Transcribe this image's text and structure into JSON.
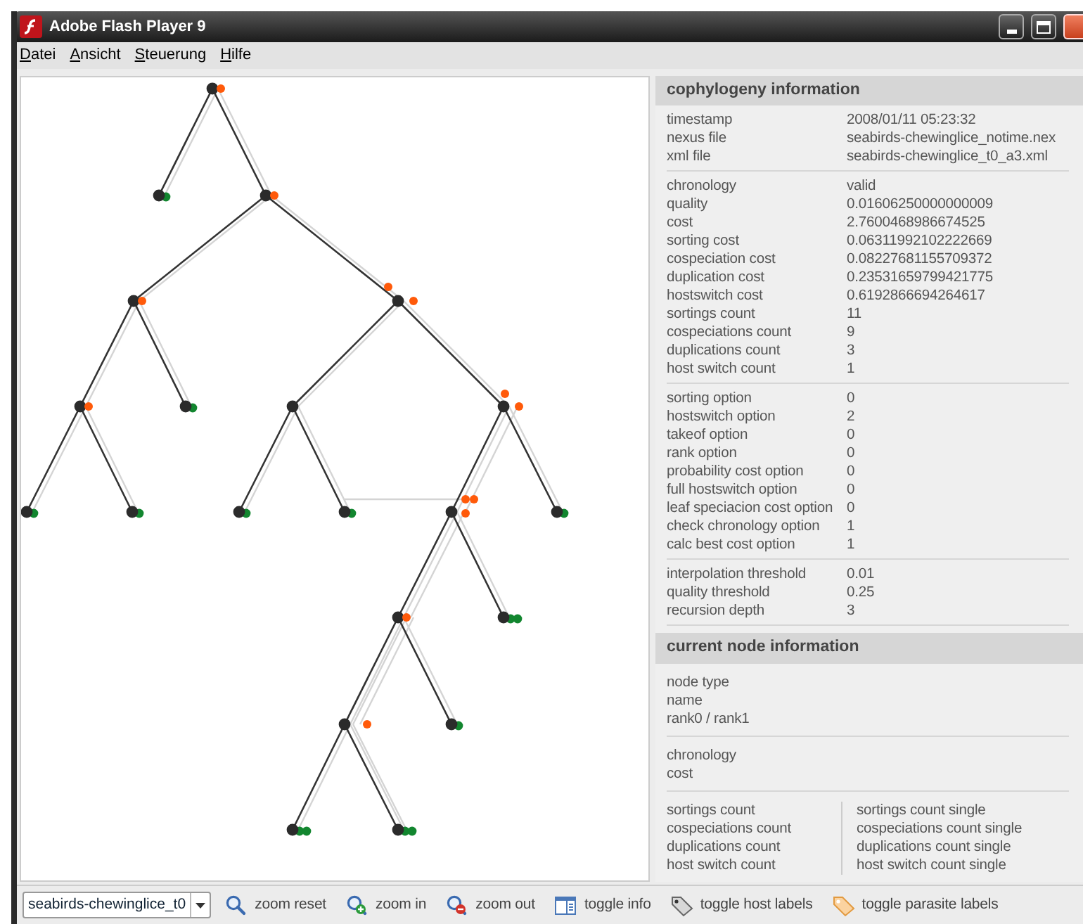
{
  "window": {
    "title": "Adobe Flash Player 9"
  },
  "menu": [
    "Datei",
    "Ansicht",
    "Steuerung",
    "Hilfe"
  ],
  "cophylogeny_information": {
    "title": "cophylogeny information",
    "groups": [
      [
        {
          "label": "timestamp",
          "value": "2008/01/11 05:23:32"
        },
        {
          "label": "nexus file",
          "value": "seabirds-chewinglice_notime.nex"
        },
        {
          "label": "xml file",
          "value": "seabirds-chewinglice_t0_a3.xml"
        }
      ],
      [
        {
          "label": "chronology",
          "value": "valid"
        },
        {
          "label": "quality",
          "value": "0.01606250000000009"
        },
        {
          "label": "cost",
          "value": "2.7600468986674525"
        },
        {
          "label": "sorting cost",
          "value": "0.06311992102222669"
        },
        {
          "label": "cospeciation cost",
          "value": "0.08227681155709372"
        },
        {
          "label": "duplication cost",
          "value": "0.23531659799421775"
        },
        {
          "label": "hostswitch cost",
          "value": "0.6192866694264617"
        },
        {
          "label": "sortings count",
          "value": "11"
        },
        {
          "label": "cospeciations count",
          "value": "9"
        },
        {
          "label": "duplications count",
          "value": "3"
        },
        {
          "label": "host switch count",
          "value": "1"
        }
      ],
      [
        {
          "label": "sorting option",
          "value": "0"
        },
        {
          "label": "hostswitch option",
          "value": "2"
        },
        {
          "label": "takeof option",
          "value": "0"
        },
        {
          "label": "rank option",
          "value": "0"
        },
        {
          "label": "probability cost option",
          "value": "0"
        },
        {
          "label": "full hostswitch option",
          "value": "0"
        },
        {
          "label": "leaf speciacion cost option",
          "value": "0"
        },
        {
          "label": "check chronology option",
          "value": "1"
        },
        {
          "label": "calc best cost option",
          "value": "1"
        }
      ],
      [
        {
          "label": "interpolation threshold",
          "value": "0.01"
        },
        {
          "label": "quality threshold",
          "value": "0.25"
        },
        {
          "label": "recursion depth",
          "value": "3"
        }
      ]
    ]
  },
  "current_node_information": {
    "title": "current node information",
    "groups": [
      [
        "node type",
        "name",
        "rank0 / rank1"
      ],
      [
        "chronology",
        "cost"
      ]
    ],
    "counts": [
      {
        "label": "sortings count",
        "single": "sortings count single"
      },
      {
        "label": "cospeciations count",
        "single": "cospeciations count single"
      },
      {
        "label": "duplications count",
        "single": "duplications count single"
      },
      {
        "label": "host switch count",
        "single": "host switch count single"
      }
    ]
  },
  "toolbar": {
    "file_select": {
      "value": "seabirds-chewinglice_t0"
    },
    "buttons": [
      {
        "label": "zoom reset",
        "kind": "zoom-reset"
      },
      {
        "label": "zoom in",
        "kind": "zoom-in"
      },
      {
        "label": "zoom out",
        "kind": "zoom-out"
      },
      {
        "label": "toggle info",
        "kind": "info"
      },
      {
        "label": "toggle host labels",
        "kind": "host-tag"
      },
      {
        "label": "toggle parasite labels",
        "kind": "parasite-tag"
      }
    ]
  }
}
